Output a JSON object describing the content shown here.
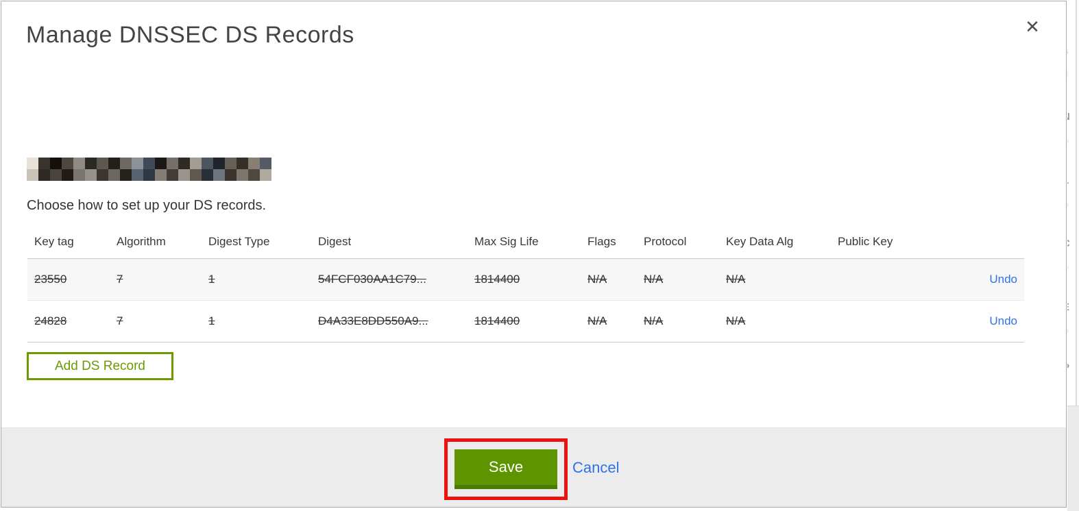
{
  "modal": {
    "title": "Manage DNSSEC DS Records",
    "close_label": "✕",
    "intro": "Choose how to set up your DS records.",
    "table": {
      "headers": [
        "Key tag",
        "Algorithm",
        "Digest Type",
        "Digest",
        "Max Sig Life",
        "Flags",
        "Protocol",
        "Key Data Alg",
        "Public Key"
      ],
      "rows": [
        {
          "key_tag": "23550",
          "algorithm": "7",
          "digest_type": "1",
          "digest": "54FCF030AA1C79...",
          "max_sig_life": "1814400",
          "flags": "N/A",
          "protocol": "N/A",
          "key_data_alg": "N/A",
          "public_key": "",
          "action": "Undo"
        },
        {
          "key_tag": "24828",
          "algorithm": "7",
          "digest_type": "1",
          "digest": "D4A33E8DD550A9...",
          "max_sig_life": "1814400",
          "flags": "N/A",
          "protocol": "N/A",
          "key_data_alg": "N/A",
          "public_key": "",
          "action": "Undo"
        }
      ]
    },
    "add_ds_record_label": "Add DS Record",
    "save_label": "Save",
    "cancel_label": "Cancel"
  },
  "colors": {
    "accent_green": "#5d9400",
    "accent_green_dark": "#4a7a00",
    "outline_green": "#6b9b00",
    "link_blue": "#2f72e3",
    "highlight_red": "#ee1111",
    "footer_gray": "#ececec",
    "row_stripe_gray": "#f7f7f7"
  },
  "background_page_fragments": {
    "f0": "s",
    "f1": "d",
    "f2": "N",
    "f3": "o",
    "f4": "L",
    "f5": "o",
    "f6": "C",
    "f7": "o",
    "f8": "E",
    "f9": "o",
    "f10": "P",
    "f11": "l"
  }
}
